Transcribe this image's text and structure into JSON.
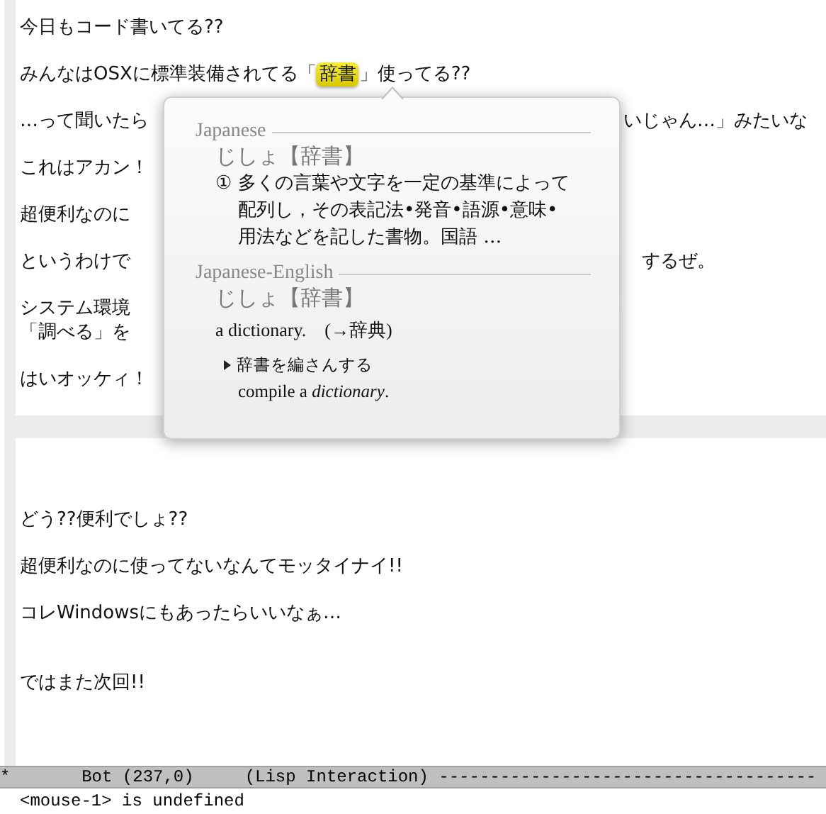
{
  "buffer": {
    "lines": [
      {
        "kind": "text",
        "segments": [
          {
            "text": "今日もコード書いてる??"
          }
        ]
      },
      {
        "kind": "blank"
      },
      {
        "kind": "text",
        "segments": [
          {
            "text": "みんなはOSXに標準装備されてる「"
          },
          {
            "text": "辞書",
            "highlighted": true
          },
          {
            "text": "」使ってる??"
          }
        ]
      },
      {
        "kind": "blank"
      },
      {
        "kind": "split",
        "left": "…って聞いたら",
        "right": "いじゃん…」みたいな"
      },
      {
        "kind": "blank"
      },
      {
        "kind": "text",
        "segments": [
          {
            "text": "これはアカン！"
          }
        ]
      },
      {
        "kind": "blank"
      },
      {
        "kind": "text",
        "segments": [
          {
            "text": "超便利なのに"
          }
        ]
      },
      {
        "kind": "blank"
      },
      {
        "kind": "split",
        "left": "というわけで",
        "right": "　するぜ。"
      },
      {
        "kind": "blank"
      },
      {
        "kind": "text",
        "segments": [
          {
            "text": "システム環境"
          }
        ]
      },
      {
        "kind": "text",
        "segments": [
          {
            "text": "「調べる」を"
          }
        ]
      },
      {
        "kind": "blank"
      },
      {
        "kind": "text",
        "segments": [
          {
            "text": "はいオッケィ！"
          }
        ]
      },
      {
        "kind": "blank"
      },
      {
        "kind": "current"
      },
      {
        "kind": "blank"
      },
      {
        "kind": "blank"
      },
      {
        "kind": "blank"
      },
      {
        "kind": "text",
        "segments": [
          {
            "text": "どう??便利でしょ??"
          }
        ]
      },
      {
        "kind": "blank"
      },
      {
        "kind": "text",
        "segments": [
          {
            "text": "超便利なのに使ってないなんてモッタイナイ!!"
          }
        ]
      },
      {
        "kind": "blank"
      },
      {
        "kind": "text",
        "segments": [
          {
            "text": "コレWindowsにもあったらいいなぁ…"
          }
        ]
      },
      {
        "kind": "blank"
      },
      {
        "kind": "blank"
      },
      {
        "kind": "text",
        "segments": [
          {
            "text": "ではまた次回!!"
          }
        ]
      }
    ]
  },
  "dictionary_popup": {
    "sections": [
      {
        "title": "Japanese",
        "headword": "じしょ【辞書】",
        "definitions": [
          {
            "number": "①",
            "text": "多くの言葉や文字を一定の基準によって配列し，その表記法•発音•語源•意味•用法などを記した書物。国語 …"
          }
        ]
      },
      {
        "title": "Japanese-English",
        "headword": "じしょ【辞書】",
        "translation": "a dictionary.　(→辞典)",
        "examples": [
          {
            "phrase": "辞書を編さんする",
            "translation": "compile a *dictionary*."
          }
        ]
      }
    ]
  },
  "mode_line": {
    "text": "*       Bot (237,0)     (Lisp Interaction) -------------------------------------"
  },
  "echo_area": {
    "text": "<mouse-1> is undefined"
  }
}
